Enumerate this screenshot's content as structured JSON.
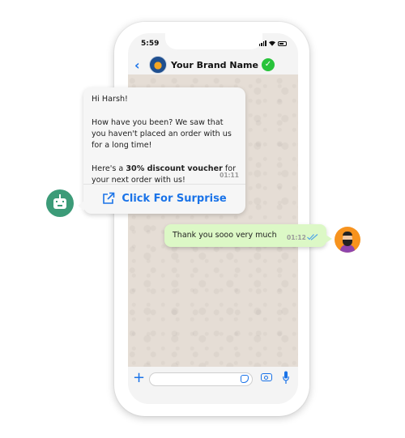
{
  "status_bar": {
    "time": "5:59"
  },
  "header": {
    "title": "Your Brand Name",
    "back_icon": "chevron-left-icon",
    "verified_icon": "check-icon"
  },
  "incoming_message": {
    "greeting": "Hi Harsh!",
    "paragraph": "How have you been? We saw that you haven't placed an order with us for a long time!",
    "offer_prefix": "Here's a ",
    "offer_bold": "30% discount voucher",
    "offer_suffix": " for your next order with us!",
    "time": "01:11",
    "cta_label": "Click For Surprise",
    "cta_icon": "external-link-icon"
  },
  "outgoing_message": {
    "text": "Thank you sooo very much",
    "time": "01:12",
    "status_icon": "double-check-icon"
  },
  "input_bar": {
    "placeholder": "",
    "icons": [
      "plus-icon",
      "sticker-icon",
      "camera-icon",
      "mic-icon"
    ]
  },
  "colors": {
    "accent": "#1a73e8",
    "verified": "#28c33a",
    "outgoing_bubble": "#dcf8c6",
    "bot_avatar": "#3c9b78",
    "user_avatar": "#f7931e",
    "wallpaper": "#e5ddd5"
  }
}
